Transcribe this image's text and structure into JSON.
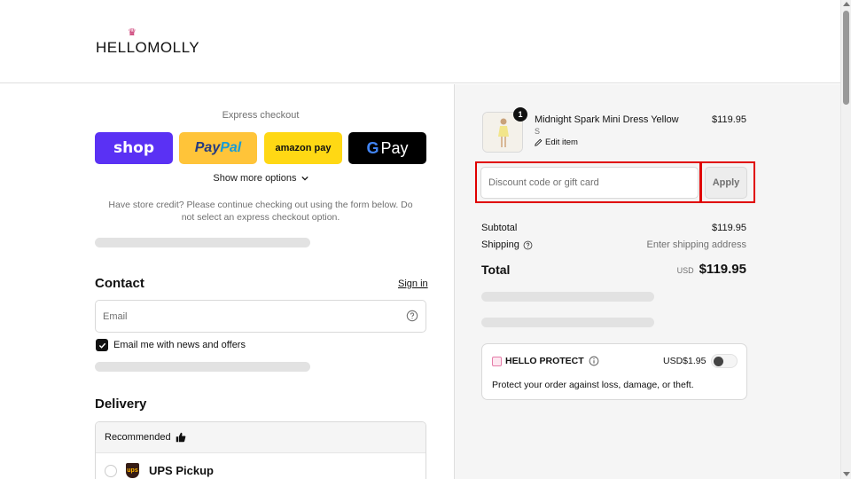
{
  "header": {
    "logo_text": "HELLOMOLLY",
    "logo_crown": "♛"
  },
  "express": {
    "title": "Express checkout",
    "buttons": {
      "shop": "shop",
      "paypal_a": "Pay",
      "paypal_b": "Pal",
      "amazon": "amazon pay",
      "gpay_g": "G",
      "gpay_text": "Pay"
    },
    "show_more": "Show more options",
    "store_credit_note": "Have store credit? Please continue checking out using the form below. Do not select an express checkout option."
  },
  "contact": {
    "title": "Contact",
    "sign_in": "Sign in",
    "email_placeholder": "Email",
    "newsletter_label": "Email me with news and offers",
    "newsletter_checked": true
  },
  "delivery": {
    "title": "Delivery",
    "recommended_label": "Recommended",
    "options": [
      {
        "label": "UPS Pickup",
        "logo_text": "ups"
      }
    ]
  },
  "summary": {
    "product": {
      "name": "Midnight Spark Mini Dress Yellow",
      "variant": "S",
      "quantity": "1",
      "price": "$119.95",
      "edit_label": "Edit item"
    },
    "discount": {
      "placeholder": "Discount code or gift card",
      "apply_label": "Apply"
    },
    "subtotal_label": "Subtotal",
    "subtotal_value": "$119.95",
    "shipping_label": "Shipping",
    "shipping_value": "Enter shipping address",
    "total_label": "Total",
    "total_currency": "USD",
    "total_value": "$119.95"
  },
  "protect": {
    "title": "HELLO PROTECT",
    "price": "USD$1.95",
    "description": "Protect your order against loss, damage, or theft.",
    "enabled": false
  },
  "colors": {
    "shop_purple": "#5a31f4",
    "paypal_yellow": "#ffc439",
    "amazon_yellow": "#ffd814",
    "highlight_red": "#e00000"
  }
}
